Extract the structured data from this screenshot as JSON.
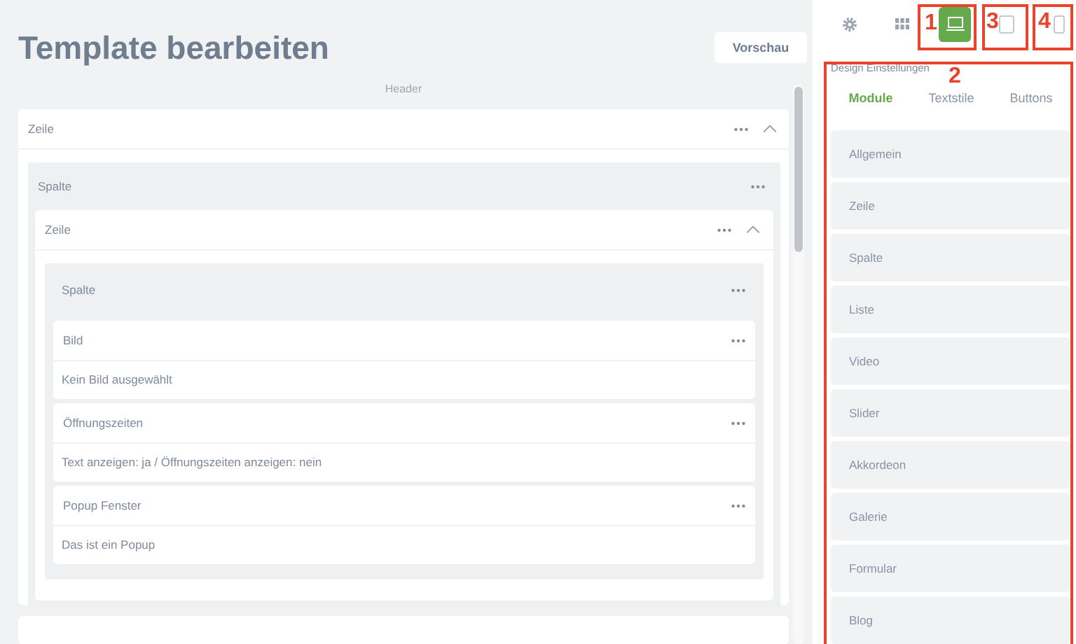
{
  "title": "Template bearbeiten",
  "preview_button": "Vorschau",
  "header_label": "Header",
  "layout": [
    {
      "kind": "row",
      "label": "Zeile",
      "expanded": true,
      "children": [
        {
          "kind": "column",
          "label": "Spalte",
          "children": [
            {
              "kind": "row",
              "label": "Zeile",
              "expanded": true,
              "children": [
                {
                  "kind": "column",
                  "label": "Spalte",
                  "children": [
                    {
                      "kind": "module",
                      "label": "Bild",
                      "summary": "Kein Bild ausgewählt"
                    },
                    {
                      "kind": "module",
                      "label": "Öffnungszeiten",
                      "summary": "Text anzeigen: ja / Öffnungszeiten anzeigen: nein"
                    },
                    {
                      "kind": "module",
                      "label": "Popup Fenster",
                      "summary": "Das ist ein Popup"
                    }
                  ]
                }
              ]
            }
          ]
        }
      ]
    },
    {
      "kind": "row"
    }
  ],
  "toolbar": [
    {
      "kind": "settings",
      "selected": false
    },
    {
      "kind": "grid",
      "selected": false
    },
    {
      "kind": "desktop",
      "selected": true
    },
    {
      "kind": "tablet",
      "selected": false
    },
    {
      "kind": "phone",
      "selected": false
    }
  ],
  "design_title": "Design Einstellungen",
  "tabs": [
    {
      "label": "Module",
      "selected": true
    },
    {
      "label": "Textstile",
      "selected": false
    },
    {
      "label": "Buttons",
      "selected": false
    }
  ],
  "modules": [
    "Allgemein",
    "Zeile",
    "Spalte",
    "Liste",
    "Video",
    "Slider",
    "Akkordeon",
    "Galerie",
    "Formular",
    "Blog"
  ],
  "callouts": [
    {
      "number": "1"
    },
    {
      "number": "2"
    },
    {
      "number": "3"
    },
    {
      "number": "4"
    }
  ]
}
